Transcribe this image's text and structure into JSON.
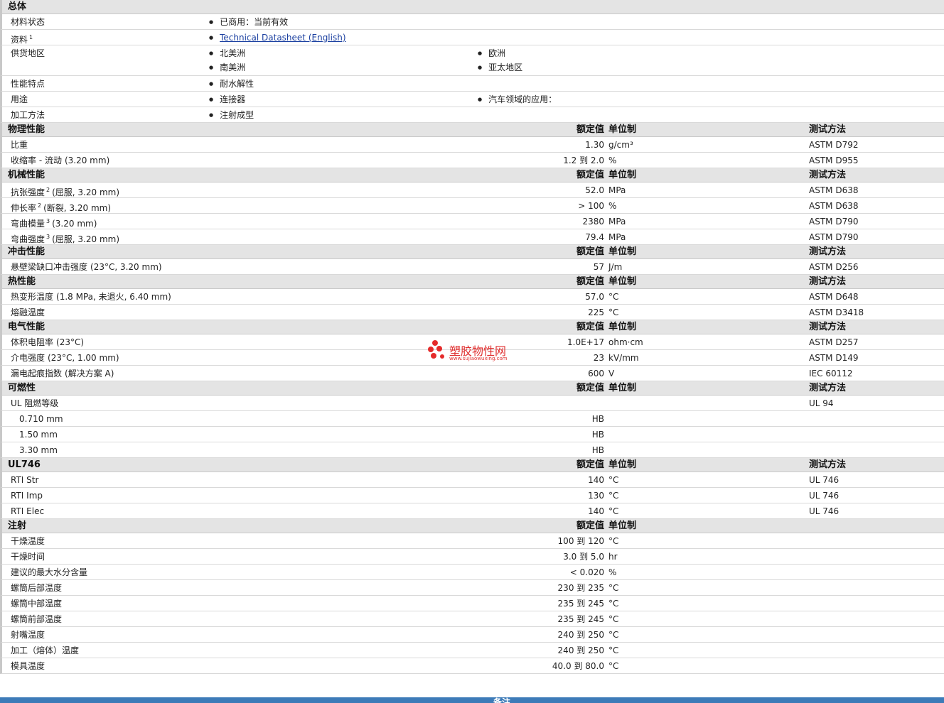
{
  "general": {
    "title": "总体",
    "status_label": "材料状态",
    "status_value": "已商用：当前有效",
    "docs_label": "资料",
    "docs_sup": "1",
    "docs_link": "Technical Datasheet (English)",
    "regions_label": "供货地区",
    "regions": [
      "北美洲",
      "欧洲",
      "南美洲",
      "亚太地区"
    ],
    "features_label": "性能特点",
    "features_value": "耐水解性",
    "uses_label": "用途",
    "uses": [
      "连接器",
      "汽车领域的应用："
    ],
    "process_label": "加工方法",
    "process_value": "注射成型"
  },
  "col_headers": {
    "nominal": "额定值",
    "unit": "单位制",
    "test": "测试方法"
  },
  "physical": {
    "title": "物理性能",
    "rows": [
      {
        "label": "比重",
        "sup": "",
        "cond": "",
        "value": "1.30",
        "unit": "g/cm³",
        "test": "ASTM D792"
      },
      {
        "label": "收缩率 - 流动",
        "sup": "",
        "cond": "(3.20 mm)",
        "value": "1.2 到  2.0",
        "unit": "%",
        "test": "ASTM D955"
      }
    ]
  },
  "mechanical": {
    "title": "机械性能",
    "rows": [
      {
        "label": "抗张强度",
        "sup": "2",
        "cond": "(屈服, 3.20 mm)",
        "value": "52.0",
        "unit": "MPa",
        "test": "ASTM D638"
      },
      {
        "label": "伸长率",
        "sup": "2",
        "cond": "(断裂, 3.20 mm)",
        "value": "> 100",
        "unit": "%",
        "test": "ASTM D638"
      },
      {
        "label": "弯曲模量",
        "sup": "3",
        "cond": "(3.20 mm)",
        "value": "2380",
        "unit": "MPa",
        "test": "ASTM D790"
      },
      {
        "label": "弯曲强度",
        "sup": "3",
        "cond": "(屈服, 3.20 mm)",
        "value": "79.4",
        "unit": "MPa",
        "test": "ASTM D790"
      }
    ]
  },
  "impact": {
    "title": "冲击性能",
    "rows": [
      {
        "label": "悬壁梁缺口冲击强度",
        "sup": "",
        "cond": "(23°C, 3.20 mm)",
        "value": "57",
        "unit": "J/m",
        "test": "ASTM D256"
      }
    ]
  },
  "thermal": {
    "title": "热性能",
    "rows": [
      {
        "label": "热变形温度",
        "sup": "",
        "cond": "(1.8 MPa, 未退火, 6.40 mm)",
        "value": "57.0",
        "unit": "°C",
        "test": "ASTM D648"
      },
      {
        "label": "熔融温度",
        "sup": "",
        "cond": "",
        "value": "225",
        "unit": "°C",
        "test": "ASTM D3418"
      }
    ]
  },
  "electrical": {
    "title": "电气性能",
    "rows": [
      {
        "label": "体积电阻率",
        "sup": "",
        "cond": "(23°C)",
        "value": "1.0E+17",
        "unit": "ohm·cm",
        "test": "ASTM D257"
      },
      {
        "label": "介电强度",
        "sup": "",
        "cond": "(23°C, 1.00 mm)",
        "value": "23",
        "unit": "kV/mm",
        "test": "ASTM D149"
      },
      {
        "label": "漏电起痕指数",
        "sup": "",
        "cond": "(解决方案 A)",
        "value": "600",
        "unit": "V",
        "test": "IEC 60112"
      }
    ]
  },
  "flammability": {
    "title": "可燃性",
    "main_label": "UL 阻燃等级",
    "main_test": "UL 94",
    "rows": [
      {
        "label": "0.710 mm",
        "value": "HB"
      },
      {
        "label": "1.50 mm",
        "value": "HB"
      },
      {
        "label": "3.30 mm",
        "value": "HB"
      }
    ]
  },
  "ul746": {
    "title": "UL746",
    "rows": [
      {
        "label": "RTI Str",
        "sup": "",
        "cond": "",
        "value": "140",
        "unit": "°C",
        "test": "UL 746"
      },
      {
        "label": "RTI Imp",
        "sup": "",
        "cond": "",
        "value": "130",
        "unit": "°C",
        "test": "UL 746"
      },
      {
        "label": "RTI Elec",
        "sup": "",
        "cond": "",
        "value": "140",
        "unit": "°C",
        "test": "UL 746"
      }
    ]
  },
  "injection": {
    "title": "注射",
    "rows": [
      {
        "label": "干燥温度",
        "sup": "",
        "cond": "",
        "value": "100 到  120",
        "unit": "°C",
        "test": ""
      },
      {
        "label": "干燥时间",
        "sup": "",
        "cond": "",
        "value": "3.0 到  5.0",
        "unit": "hr",
        "test": ""
      },
      {
        "label": "建议的最大水分含量",
        "sup": "",
        "cond": "",
        "value": "< 0.020",
        "unit": "%",
        "test": ""
      },
      {
        "label": "螺筒后部温度",
        "sup": "",
        "cond": "",
        "value": "230 到  235",
        "unit": "°C",
        "test": ""
      },
      {
        "label": "螺筒中部温度",
        "sup": "",
        "cond": "",
        "value": "235 到  245",
        "unit": "°C",
        "test": ""
      },
      {
        "label": "螺筒前部温度",
        "sup": "",
        "cond": "",
        "value": "235 到  245",
        "unit": "°C",
        "test": ""
      },
      {
        "label": "射嘴温度",
        "sup": "",
        "cond": "",
        "value": "240 到  250",
        "unit": "°C",
        "test": ""
      },
      {
        "label": "加工（熔体）温度",
        "sup": "",
        "cond": "",
        "value": "240 到  250",
        "unit": "°C",
        "test": ""
      },
      {
        "label": "模具温度",
        "sup": "",
        "cond": "",
        "value": "40.0 到  80.0",
        "unit": "°C",
        "test": ""
      }
    ]
  },
  "footer": {
    "label": "备注"
  },
  "watermark": {
    "text": "塑胶物性网",
    "url": "www.sujiaowuxing.com"
  }
}
